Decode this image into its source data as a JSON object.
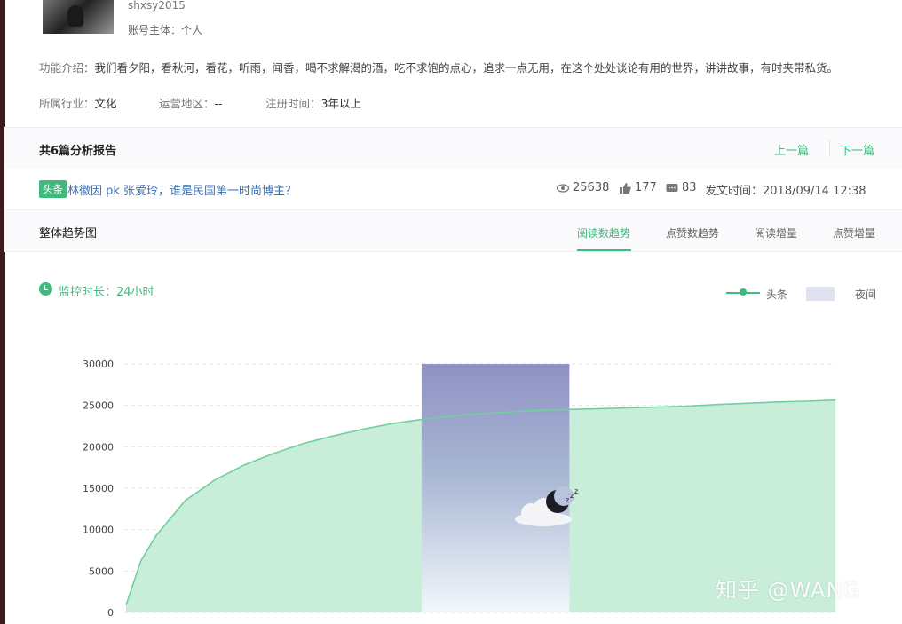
{
  "account": {
    "name": "shxsy2015",
    "subject_label": "账号主体：",
    "subject_value": "个人"
  },
  "description": {
    "label": "功能介绍：",
    "text": "我们看夕阳，看秋河，看花，听雨，闻香，喝不求解渴的酒，吃不求饱的点心，追求一点无用，在这个处处谈论有用的世界，讲讲故事，有时夹带私货。"
  },
  "meta": {
    "industry_label": "所属行业：",
    "industry_value": "文化",
    "region_label": "运营地区：",
    "region_value": "--",
    "registered_label": "注册时间：",
    "registered_value": "3年以上"
  },
  "reports": {
    "title": "共6篇分析报告",
    "prev": "上一篇",
    "next": "下一篇"
  },
  "article": {
    "tag": "头条",
    "title": "林徽因 pk 张爱玲，谁是民国第一时尚博主？",
    "reads": "25638",
    "likes": "177",
    "comments": "83",
    "time_label": "发文时间：",
    "time_value": "2018/09/14 12:38"
  },
  "trend": {
    "title": "整体趋势图",
    "tabs": [
      "阅读数趋势",
      "点赞数趋势",
      "阅读增量",
      "点赞增量"
    ],
    "active_tab": 0,
    "monitor": "监控时长：24小时",
    "legend_series": "头条",
    "legend_night": "夜间"
  },
  "colors": {
    "accent": "#3fb97c",
    "area": "#c8edd9",
    "night": "#8f92c3",
    "link": "#3a6fb5"
  },
  "icons": [
    "eye-icon",
    "thumb-up-icon",
    "comment-icon",
    "clock-icon",
    "moon-icon",
    "cloud-icon"
  ],
  "chart_data": {
    "type": "area",
    "yticks": [
      "30000",
      "25000",
      "20000",
      "15000",
      "10000",
      "5000",
      "0"
    ],
    "ylim": [
      0,
      30000
    ],
    "xlim": [
      0,
      24
    ],
    "grid": true,
    "legend_placement": "top-right",
    "series": [
      {
        "name": "头条",
        "x": [
          0,
          0.5,
          1,
          2,
          3,
          4,
          5,
          6,
          7,
          8,
          9,
          10,
          11,
          12,
          13,
          14,
          15,
          16,
          17,
          18,
          19,
          20,
          21,
          22,
          23,
          24
        ],
        "values": [
          900,
          6200,
          9200,
          13500,
          16000,
          17800,
          19200,
          20400,
          21300,
          22100,
          22800,
          23300,
          23700,
          24000,
          24200,
          24400,
          24500,
          24600,
          24700,
          24800,
          24900,
          25100,
          25250,
          25400,
          25500,
          25638
        ]
      }
    ],
    "night_band": [
      10,
      15
    ]
  }
}
